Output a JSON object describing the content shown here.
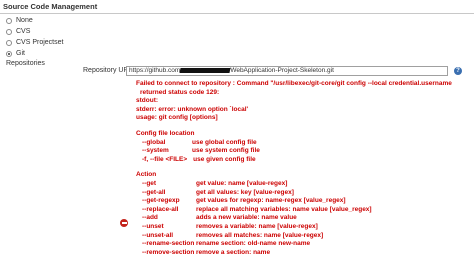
{
  "section": {
    "title": "Source Code Management"
  },
  "scm_options": [
    {
      "label": "None",
      "selected": false
    },
    {
      "label": "CVS",
      "selected": false
    },
    {
      "label": "CVS Projectset",
      "selected": false
    },
    {
      "label": "Git",
      "selected": true
    }
  ],
  "repositories_label": "Repositories",
  "repository": {
    "url_label": "Repository URL",
    "url_prefix": "https://github.com",
    "url_suffix": "WebApplication-Project-Skeleton.git"
  },
  "error": {
    "lines": [
      "Failed to connect to repository : Command \"/usr/libexec/git-core/git config --local credential.username",
      "returned status code 129:",
      "stdout:",
      "stderr: error: unknown option `local'",
      "usage: git config [options]"
    ],
    "config_heading": "Config file location",
    "config_options": [
      {
        "flag": "--global",
        "desc": "use global config file"
      },
      {
        "flag": "--system",
        "desc": "use system config file"
      },
      {
        "flag": "-f, --file <FILE>",
        "desc": "use given config file"
      }
    ],
    "action_heading": "Action",
    "actions": [
      {
        "flag": "--get",
        "desc": "get value: name [value-regex]"
      },
      {
        "flag": "--get-all",
        "desc": "get all values: key [value-regex]"
      },
      {
        "flag": "--get-regexp",
        "desc": "get values for regexp: name-regex [value_regex]"
      },
      {
        "flag": "--replace-all",
        "desc": "replace all matching variables: name value [value_regex]"
      },
      {
        "flag": "--add",
        "desc": "adds a new variable: name value"
      },
      {
        "flag": "--unset",
        "desc": "removes a variable: name [value-regex]"
      },
      {
        "flag": "--unset-all",
        "desc": "removes all matches: name [value-regex]"
      },
      {
        "flag": "--rename-section",
        "desc": "rename section: old-name new-name"
      },
      {
        "flag": "--remove-section",
        "desc": "remove a section: name"
      }
    ]
  },
  "icons": {
    "help": "help-icon",
    "delete": "delete-icon"
  }
}
